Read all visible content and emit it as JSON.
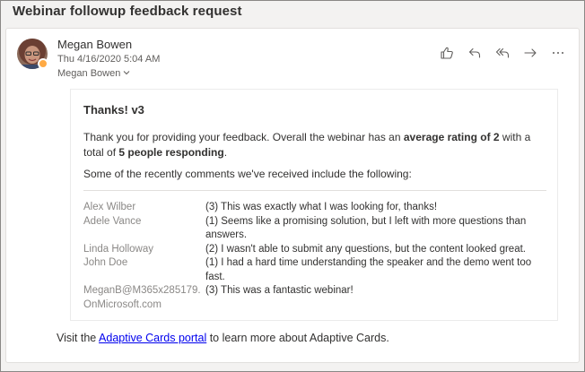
{
  "subject": "Webinar followup feedback request",
  "message": {
    "sender": "Megan Bowen",
    "date": "Thu 4/16/2020 5:04 AM",
    "to": "Megan Bowen",
    "actions": [
      "like-icon",
      "reply-icon",
      "reply-all-icon",
      "forward-icon",
      "more-icon"
    ]
  },
  "card": {
    "title": "Thanks! v3",
    "summary_prefix": "Thank you for providing your feedback. Overall the webinar has an ",
    "summary_rating": "average rating of 2",
    "summary_middle": " with a total of ",
    "summary_count": "5 people responding",
    "summary_suffix": ".",
    "intro": "Some of the recently comments we've received include the following:",
    "comments": [
      {
        "name": "Alex Wilber",
        "text": "(3) This was exactly what I was looking for, thanks!"
      },
      {
        "name": "Adele Vance",
        "text": "(1) Seems like a promising solution, but I left with more questions than answers."
      },
      {
        "name": "Linda Holloway",
        "text": "(2) I wasn't able to submit any questions, but the content looked great."
      },
      {
        "name": "John Doe",
        "text": "(1) I had a hard time understanding the speaker and the demo went too fast."
      },
      {
        "name": "MeganB@M365x285179.OnMicrosoft.com",
        "text": "(3) This was a fantastic webinar!"
      }
    ]
  },
  "footer": {
    "prefix": "Visit the ",
    "link": "Adaptive Cards portal",
    "suffix": " to learn more about Adaptive Cards."
  },
  "colors": {
    "presence": "#ffaa44",
    "link": "#0000ee",
    "icon": "#605e5c"
  }
}
